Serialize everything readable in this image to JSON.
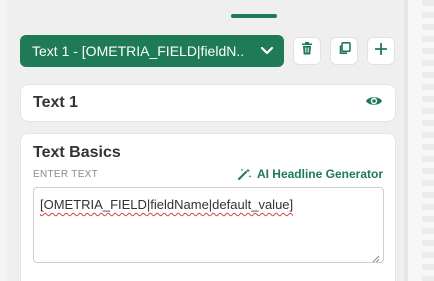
{
  "toolbar": {
    "element_select_label": "Text 1 - [OMETRIA_FIELD|fieldN..",
    "accent": "#1e7a57"
  },
  "name_card": {
    "title": "Text 1"
  },
  "basics": {
    "title": "Text Basics",
    "enter_label": "ENTER TEXT",
    "ai_link": "AI Headline Generator",
    "text_value": "[OMETRIA_FIELD|fieldName|default_value]"
  }
}
